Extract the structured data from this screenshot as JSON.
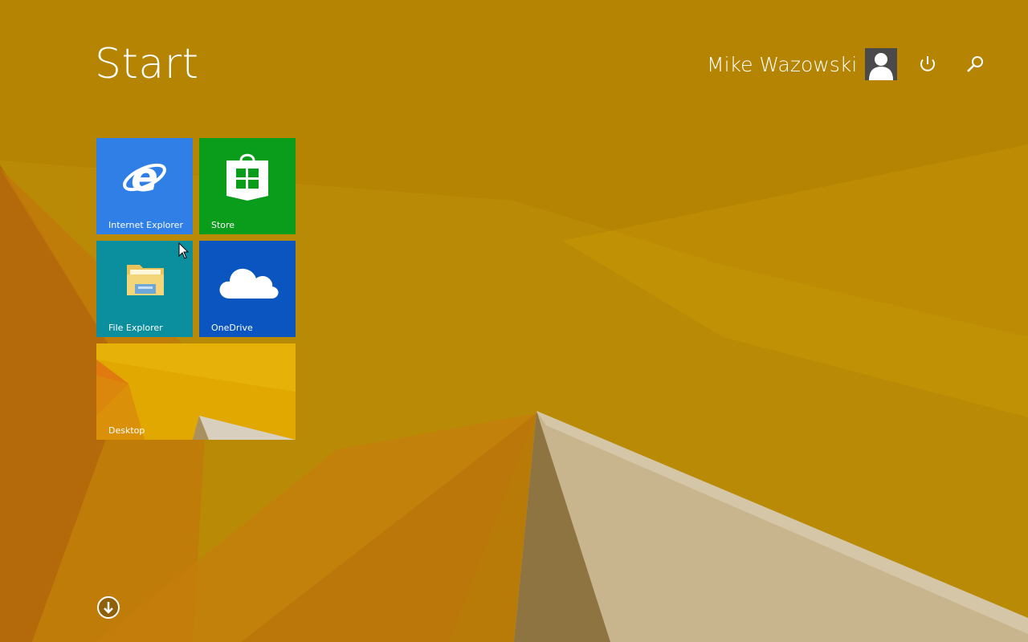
{
  "screen": {
    "title": "Start",
    "wallpaper": "yellow-abstract",
    "background_color": "#b98a05"
  },
  "header": {
    "user_name": "Mike Wazowski",
    "avatar_icon": "user-silhouette-icon",
    "power_icon": "power-icon",
    "search_icon": "search-icon"
  },
  "tiles": [
    {
      "label": "Internet Explorer",
      "icon": "internet-explorer-icon",
      "color": "#2f7fe6"
    },
    {
      "label": "Store",
      "icon": "store-icon",
      "color": "#0a9c1b"
    },
    {
      "label": "File Explorer",
      "icon": "folder-icon",
      "color": "#0b8f9e"
    },
    {
      "label": "OneDrive",
      "icon": "cloud-icon",
      "color": "#0a55c0"
    },
    {
      "label": "Desktop",
      "icon": "desktop-wallpaper-thumbnail",
      "color": "#e0a800"
    }
  ],
  "footer": {
    "all_apps_icon": "down-arrow-circle-icon"
  }
}
